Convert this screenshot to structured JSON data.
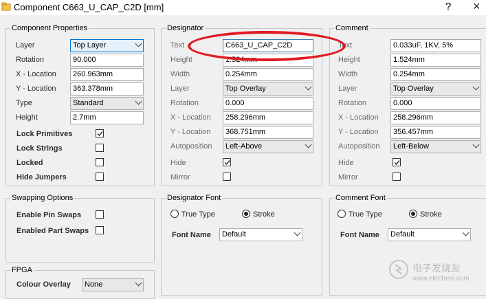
{
  "window": {
    "title": "Component C663_U_CAP_C2D [mm]",
    "help": "?",
    "close": "×"
  },
  "component_properties": {
    "title": "Component Properties",
    "layer": {
      "label": "Layer",
      "value": "Top Layer"
    },
    "rotation": {
      "label": "Rotation",
      "value": "90.000"
    },
    "x_location": {
      "label": "X - Location",
      "value": "260.963mm"
    },
    "y_location": {
      "label": "Y - Location",
      "value": "363.378mm"
    },
    "type": {
      "label": "Type",
      "value": "Standard"
    },
    "height": {
      "label": "Height",
      "value": "2.7mm"
    },
    "lock_primitives": {
      "label": "Lock Primitives",
      "checked": true
    },
    "lock_strings": {
      "label": "Lock Strings",
      "checked": false
    },
    "locked": {
      "label": "Locked",
      "checked": false
    },
    "hide_jumpers": {
      "label": "Hide Jumpers",
      "checked": false
    }
  },
  "swapping_options": {
    "title": "Swapping Options",
    "enable_pin_swaps": {
      "label": "Enable Pin Swaps",
      "checked": false
    },
    "enable_part_swaps": {
      "label": "Enabled Part Swaps",
      "checked": false
    }
  },
  "fpga": {
    "title": "FPGA",
    "colour_overlay": {
      "label": "Colour Overlay",
      "value": "None"
    }
  },
  "designator": {
    "title": "Designator",
    "text": {
      "label": "Text",
      "value": "C663_U_CAP_C2D"
    },
    "height": {
      "label": "Height",
      "value": "1.524mm"
    },
    "width": {
      "label": "Width",
      "value": "0.254mm"
    },
    "layer": {
      "label": "Layer",
      "value": "Top Overlay"
    },
    "rotation": {
      "label": "Rotation",
      "value": "0.000"
    },
    "x_location": {
      "label": "X - Location",
      "value": "258.296mm"
    },
    "y_location": {
      "label": "Y - Location",
      "value": "368.751mm"
    },
    "autoposition": {
      "label": "Autoposition",
      "value": "Left-Above"
    },
    "hide": {
      "label": "Hide",
      "checked": true
    },
    "mirror": {
      "label": "Mirror",
      "checked": false
    }
  },
  "designator_font": {
    "title": "Designator Font",
    "true_type": "True Type",
    "stroke": "Stroke",
    "font_name": {
      "label": "Font Name",
      "value": "Default"
    }
  },
  "comment": {
    "title": "Comment",
    "text": {
      "label": "Text",
      "value": "0.033uF, 1KV, 5%"
    },
    "height": {
      "label": "Height",
      "value": "1.524mm"
    },
    "width": {
      "label": "Width",
      "value": "0.254mm"
    },
    "layer": {
      "label": "Layer",
      "value": "Top Overlay"
    },
    "rotation": {
      "label": "Rotation",
      "value": "0.000"
    },
    "x_location": {
      "label": "X - Location",
      "value": "258.296mm"
    },
    "y_location": {
      "label": "Y - Location",
      "value": "356.457mm"
    },
    "autoposition": {
      "label": "Autoposition",
      "value": "Left-Below"
    },
    "hide": {
      "label": "Hide",
      "checked": true
    },
    "mirror": {
      "label": "Mirror",
      "checked": false
    }
  },
  "comment_font": {
    "title": "Comment Font",
    "true_type": "True Type",
    "stroke": "Stroke",
    "font_name": {
      "label": "Font Name",
      "value": "Default"
    }
  },
  "watermark": {
    "text": "电子发烧友",
    "url": "www.elecfans.com"
  },
  "colors": {
    "annotation_red": "#e01b22",
    "focus_blue": "#3c7fb1"
  }
}
